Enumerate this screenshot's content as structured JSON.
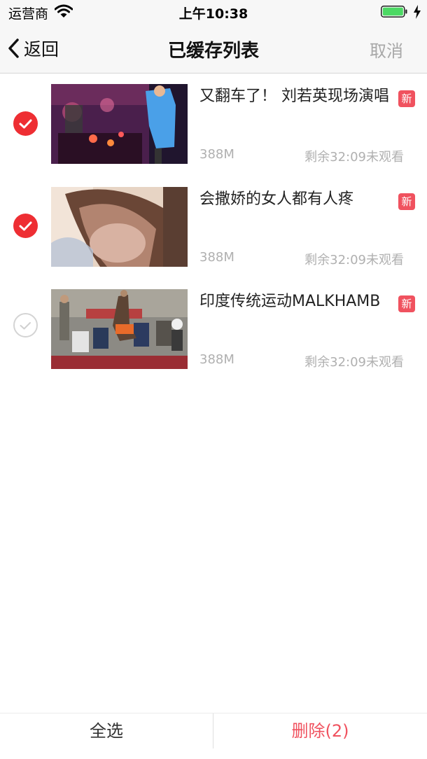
{
  "status_bar": {
    "carrier": "运营商",
    "time": "上午10:38",
    "battery_color": "#4cd964"
  },
  "nav": {
    "back_label": "返回",
    "title": "已缓存列表",
    "cancel_label": "取消"
  },
  "colors": {
    "accent_red": "#ee2e33",
    "badge_red": "#f0525f",
    "meta_gray": "#b0b0b0"
  },
  "videos": [
    {
      "title": "又翻车了！ 刘若英现场演唱",
      "badge": "新",
      "size": "388M",
      "remaining": "剩余32:09未观看",
      "selected": true,
      "thumbnail": "concert-stage"
    },
    {
      "title": "会撒娇的女人都有人疼",
      "badge": "新",
      "size": "388M",
      "remaining": "剩余32:09未观看",
      "selected": true,
      "thumbnail": "woman-closeup"
    },
    {
      "title": "印度传统运动MALKHAMB",
      "badge": "新",
      "size": "388M",
      "remaining": "剩余32:09未观看",
      "selected": false,
      "thumbnail": "gym-performance"
    }
  ],
  "bottom_bar": {
    "select_all_label": "全选",
    "delete_label": "删除(2)"
  }
}
